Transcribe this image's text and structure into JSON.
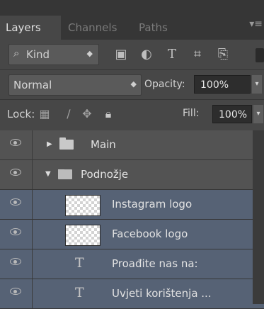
{
  "tabs": [
    {
      "label": "Layers",
      "active": true
    },
    {
      "label": "Channels",
      "active": false
    },
    {
      "label": "Paths",
      "active": false
    }
  ],
  "filter": {
    "kind_label": "Kind",
    "icons": [
      "pixel-layer-filter-icon",
      "adjustment-layer-filter-icon",
      "type-layer-filter-icon",
      "shape-layer-filter-icon",
      "smart-object-filter-icon"
    ]
  },
  "blend": {
    "mode": "Normal",
    "opacity_label": "Opacity:",
    "opacity_value": "100%"
  },
  "lock": {
    "label": "Lock:",
    "icons": [
      "lock-transparent-pixels-icon",
      "lock-image-pixels-icon",
      "lock-position-icon",
      "lock-all-icon"
    ],
    "fill_label": "Fill:",
    "fill_value": "100%"
  },
  "layers": [
    {
      "name": "Main",
      "kind": "group",
      "expanded": false,
      "selected": false,
      "visible": true
    },
    {
      "name": "Podnožje",
      "kind": "group",
      "expanded": true,
      "selected": false,
      "visible": true
    },
    {
      "name": "Instagram logo",
      "kind": "pixel",
      "selected": true,
      "visible": true
    },
    {
      "name": "Facebook logo",
      "kind": "pixel",
      "selected": true,
      "visible": true
    },
    {
      "name": "Proađite nas na:",
      "kind": "type",
      "selected": true,
      "visible": true
    },
    {
      "name": "Uvjeti korištenja  ...",
      "kind": "type",
      "selected": true,
      "visible": true
    }
  ],
  "colors": {
    "panel_bg": "#474747",
    "selected_row": "#566275",
    "tab_bar": "#363636"
  }
}
